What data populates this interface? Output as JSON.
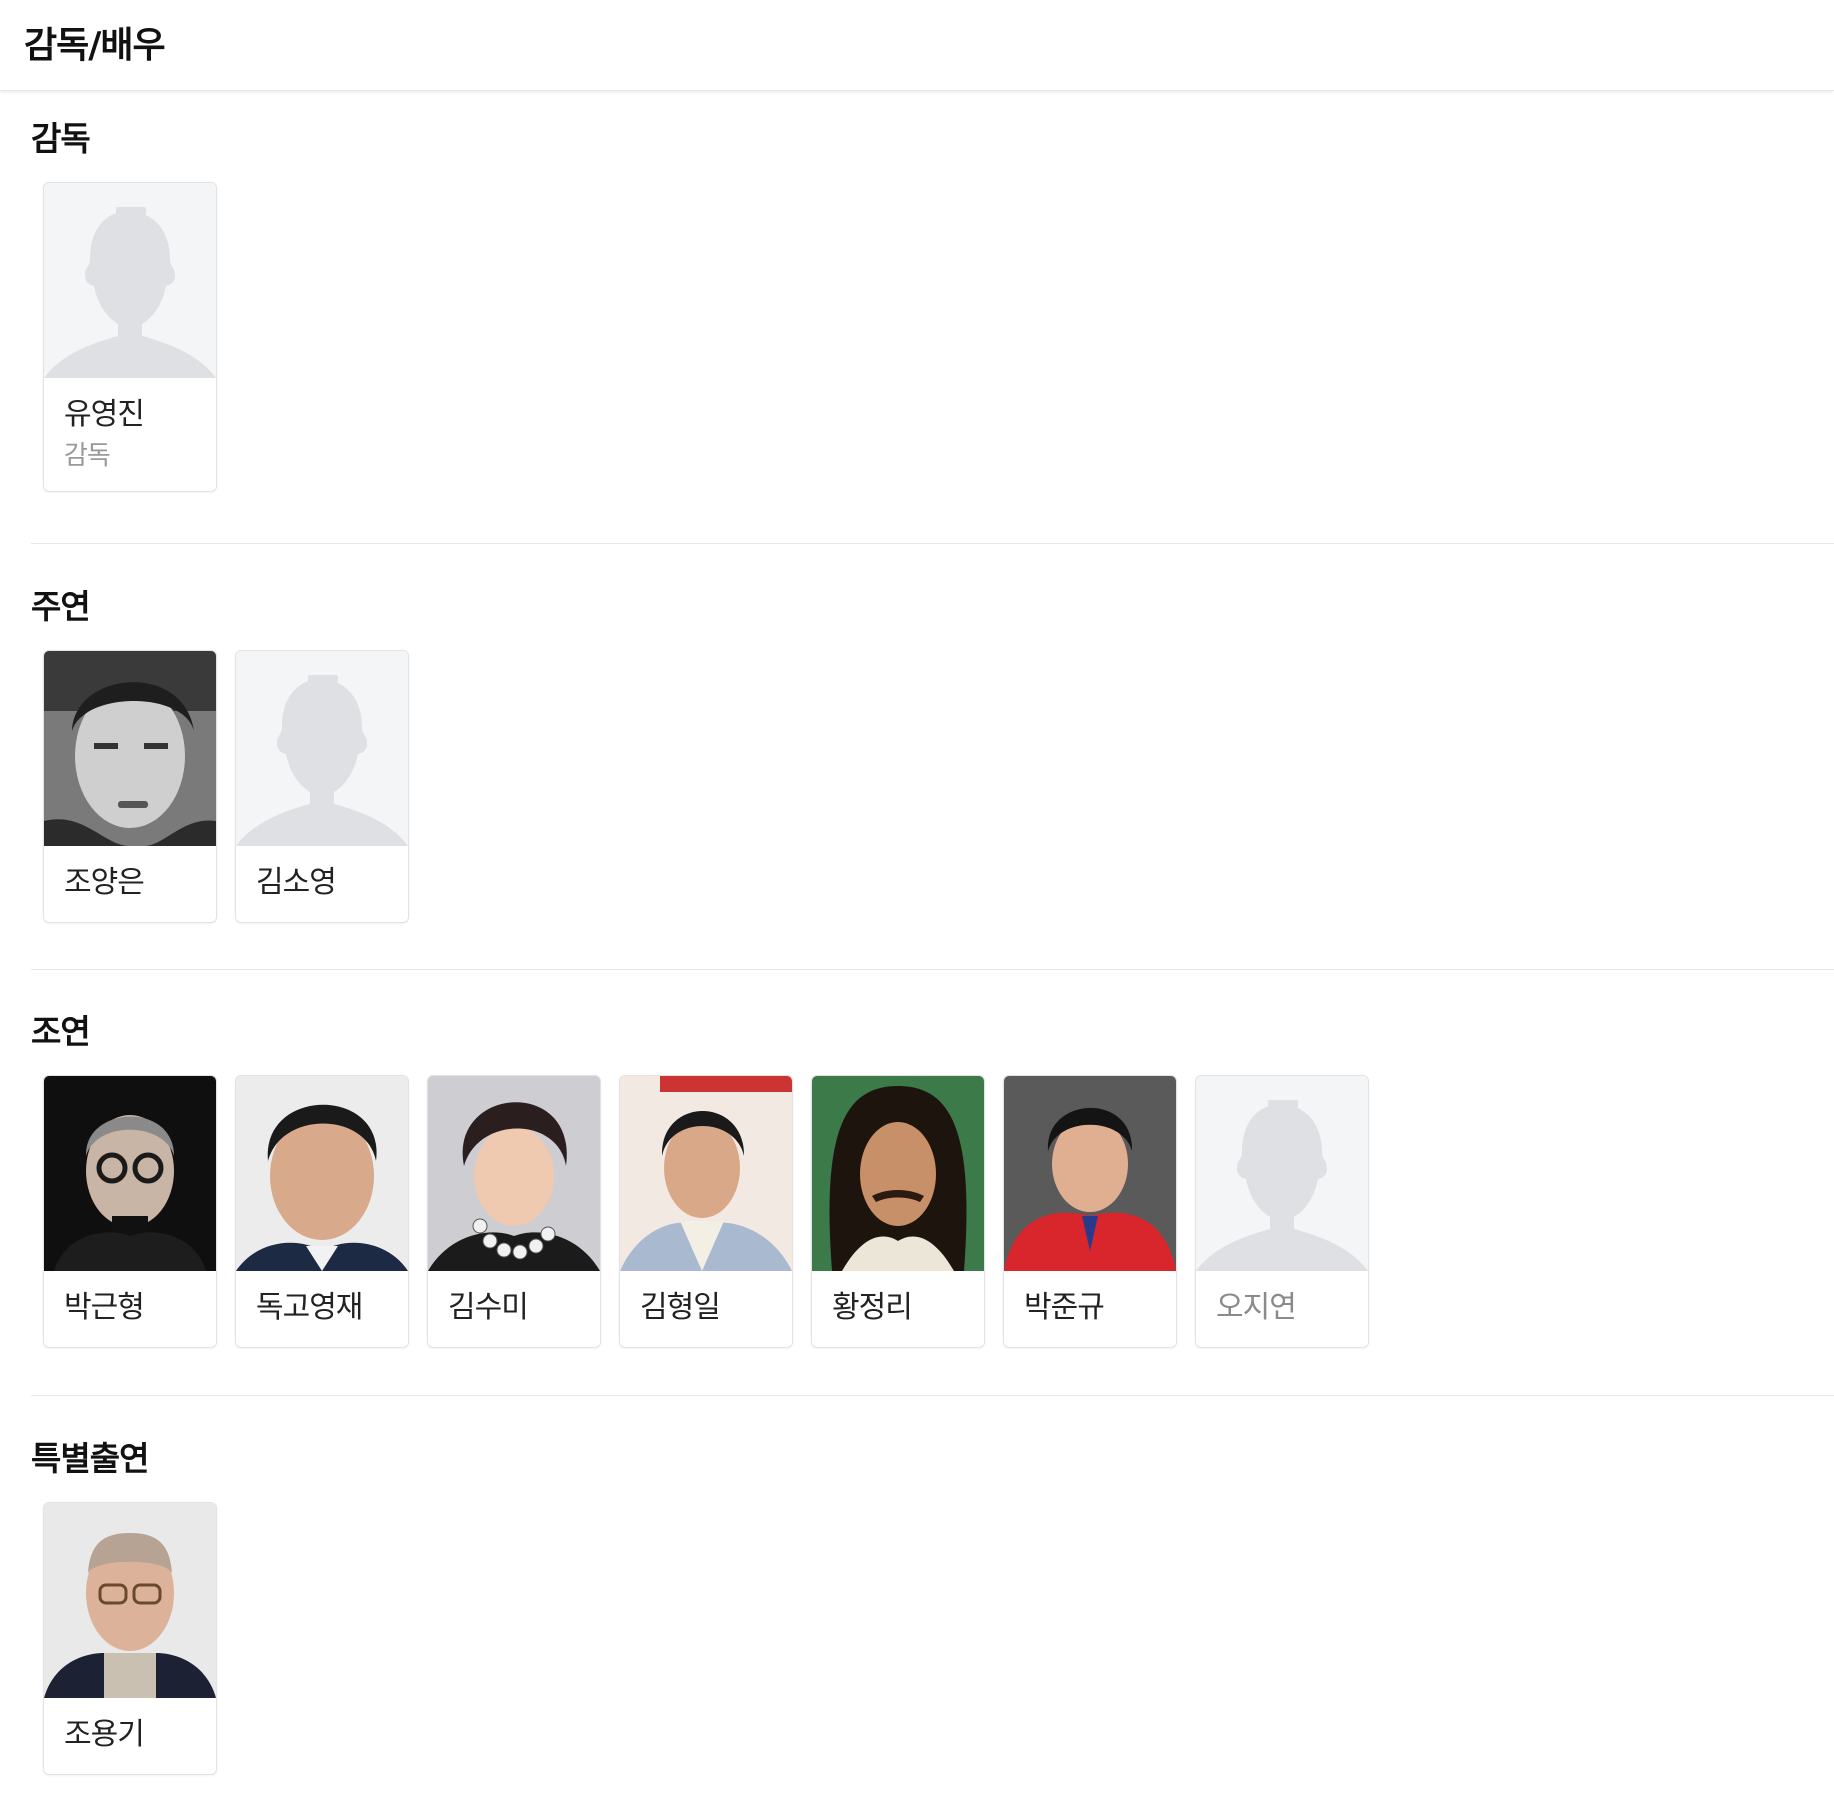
{
  "page": {
    "title": "감독/배우"
  },
  "sections": [
    {
      "heading": "감독",
      "people": [
        {
          "name": "유영진",
          "role": "감독",
          "photo": "placeholder-silhouette"
        }
      ]
    },
    {
      "heading": "주연",
      "people": [
        {
          "name": "조양은",
          "photo": "grayscale-portrait"
        },
        {
          "name": "김소영",
          "photo": "placeholder-silhouette"
        }
      ]
    },
    {
      "heading": "조연",
      "people": [
        {
          "name": "박근형",
          "photo": "portrait-dark-background"
        },
        {
          "name": "독고영재",
          "photo": "portrait-light-background"
        },
        {
          "name": "김수미",
          "photo": "portrait-gray-background"
        },
        {
          "name": "김형일",
          "photo": "portrait-event-backdrop"
        },
        {
          "name": "황정리",
          "photo": "portrait-vintage"
        },
        {
          "name": "박준규",
          "photo": "portrait-red-background"
        },
        {
          "name": "오지연",
          "photo": "placeholder-silhouette"
        }
      ]
    },
    {
      "heading": "특별출연",
      "people": [
        {
          "name": "조용기",
          "photo": "portrait-studio"
        }
      ]
    }
  ],
  "colors": {
    "placeholder_bg": "#f4f5f7",
    "placeholder_figure": "#dfe0e3",
    "divider": "#e8e8e8",
    "card_border": "#e2e2e2",
    "dim_text": "#8a8a8a"
  }
}
